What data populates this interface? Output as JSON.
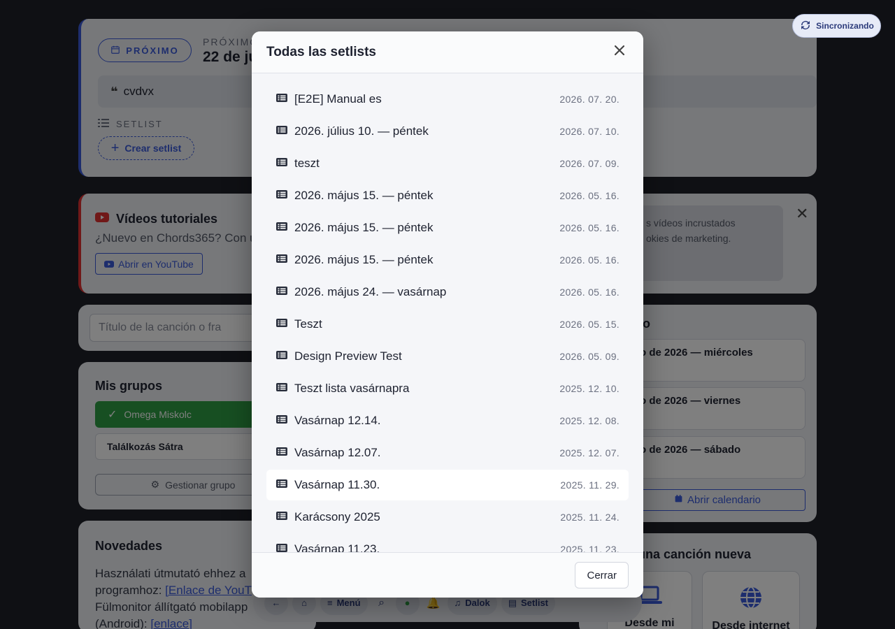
{
  "sync": {
    "label": "Sincronizando"
  },
  "next_card": {
    "badge": "PRÓXIMO",
    "eyebrow": "PRÓXIMO",
    "date_title": "22 de ju",
    "note": "cvdvx",
    "setlist_label": "SETLIST",
    "create_button": "Crear setlist"
  },
  "videos_card": {
    "title": "Vídeos tutoriales",
    "text": "¿Nuevo en Chords365? Con u",
    "youtube_button": "Abrir en YouTube",
    "consent_line1": "s vídeos incrustados",
    "consent_line2": "okies de marketing."
  },
  "search": {
    "placeholder": "Título de la canción o fra"
  },
  "calendar": {
    "title_fragment": "io",
    "items": [
      "o de 2026 — miércoles",
      "o de 2026 — viernes",
      "o de 2026 — sábado"
    ],
    "open_button": "Abrir calendario"
  },
  "groups": {
    "title": "Mis grupos",
    "active": "Omega Miskolc",
    "other": "Találkozás Sátra",
    "manage_button": "Gestionar grupo"
  },
  "news": {
    "title": "Novedades",
    "line1": "Használati útmutató ehhez a",
    "line2_prefix": "programhoz: ",
    "line2_link": "[Enlace de YouT",
    "line3": "Fülmonitor állítgató mobilapp",
    "line4_prefix": "(Android): ",
    "line4_link": "[enlace]"
  },
  "new_song": {
    "title": "una canción nueva",
    "option1": "Desde mi",
    "option2": "Desde internet"
  },
  "bottom_nav": {
    "menu": "Menú",
    "songs": "Dalok",
    "setlist": "Setlist"
  },
  "modal": {
    "title": "Todas las setlists",
    "close_label": "Cerrar",
    "setlists": [
      {
        "name": "[E2E] Manual es",
        "date": "2026. 07. 20."
      },
      {
        "name": "2026. július 10. — péntek",
        "date": "2026. 07. 10."
      },
      {
        "name": "teszt",
        "date": "2026. 07. 09."
      },
      {
        "name": "2026. május 15. — péntek",
        "date": "2026. 05. 16."
      },
      {
        "name": "2026. május 15. — péntek",
        "date": "2026. 05. 16."
      },
      {
        "name": "2026. május 15. — péntek",
        "date": "2026. 05. 16."
      },
      {
        "name": "2026. május 24. — vasárnap",
        "date": "2026. 05. 16."
      },
      {
        "name": "Teszt",
        "date": "2026. 05. 15."
      },
      {
        "name": "Design Preview Test",
        "date": "2026. 05. 09."
      },
      {
        "name": "Teszt lista vasárnapra",
        "date": "2025. 12. 10."
      },
      {
        "name": "Vasárnap 12.14.",
        "date": "2025. 12. 08."
      },
      {
        "name": "Vasárnap 12.07.",
        "date": "2025. 12. 07."
      },
      {
        "name": "Vasárnap 11.30.",
        "date": "2025. 11. 29."
      },
      {
        "name": "Karácsony 2025",
        "date": "2025. 11. 24."
      },
      {
        "name": "Vasárnap 11.23.",
        "date": "2025. 11. 23."
      }
    ]
  },
  "colors": {
    "accent": "#3b5bdb",
    "success": "#2f9e44",
    "danger": "#e03131"
  }
}
